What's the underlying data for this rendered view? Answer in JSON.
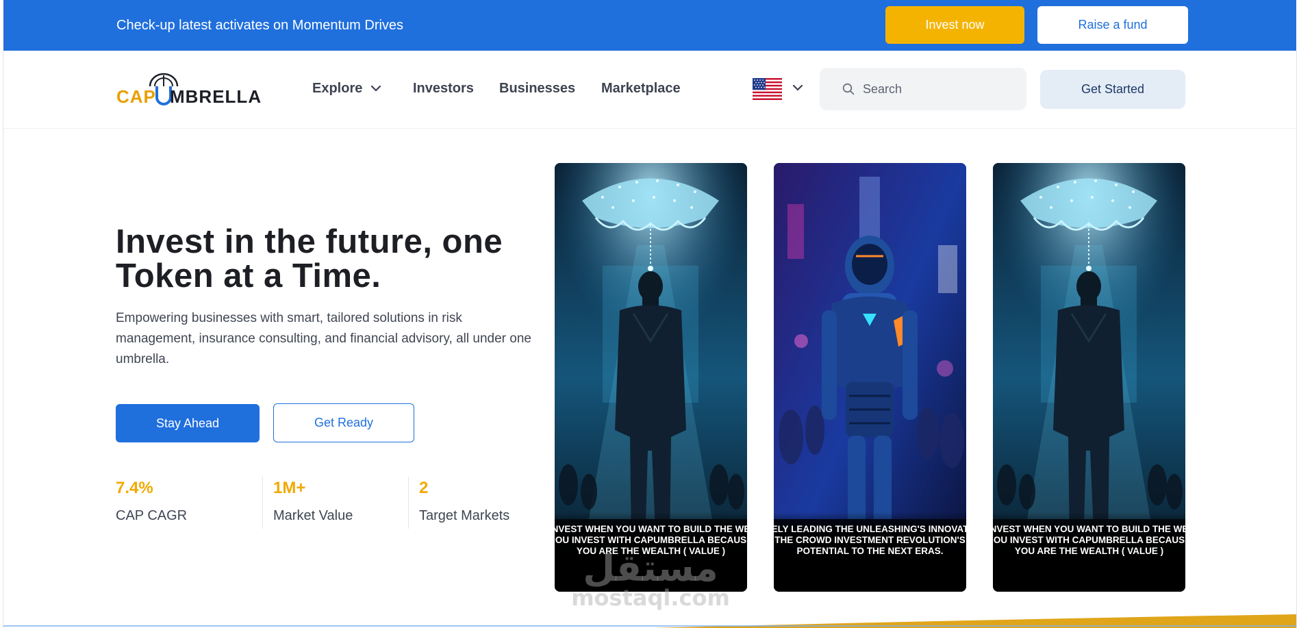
{
  "topbar": {
    "text": "Check-up latest activates on  Momentum Drives",
    "invest_label": "Invest now",
    "raise_label": "Raise a fund",
    "bg_color": "#1f6fdd",
    "invest_color": "#f5b301"
  },
  "logo": {
    "part1": "CAP",
    "part2": "MBRELLA"
  },
  "nav": {
    "explore": "Explore",
    "investors": "Investors",
    "businesses": "Businesses",
    "marketplace": "Marketplace"
  },
  "language": {
    "flag": "us-flag-icon"
  },
  "search": {
    "placeholder": "Search"
  },
  "header": {
    "get_started_label": "Get Started"
  },
  "hero": {
    "title": "Invest in the future, one Token at a Time.",
    "description": "Empowering businesses with smart, tailored solutions in risk management, insurance consulting, and financial advisory, all under one umbrella.",
    "stay_ahead_label": "Stay Ahead",
    "get_ready_label": "Get Ready"
  },
  "stats": [
    {
      "value": "7.4%",
      "label": "CAP CAGR"
    },
    {
      "value": "1M+",
      "label": "Market Value"
    },
    {
      "value": "2",
      "label": "Target Markets"
    }
  ],
  "cards": [
    {
      "caption_l1": "NVEST WHEN YOU WANT TO BUILD THE WE",
      "caption_l2": "OU INVEST WITH CAPUMBRELLA BECAUS",
      "caption_l3": "YOU ARE THE WEALTH ( VALUE )"
    },
    {
      "caption_l1": "ELY LEADING THE UNLEASHING'S INNOVAT",
      "caption_l2": "THE CROWD INVESTMENT REVOLUTION'S",
      "caption_l3": "POTENTIAL TO THE NEXT ERAS."
    },
    {
      "caption_l1": "NVEST WHEN YOU WANT TO BUILD THE WE",
      "caption_l2": "OU INVEST WITH CAPUMBRELLA BECAUS",
      "caption_l3": "YOU ARE THE WEALTH ( VALUE )"
    }
  ],
  "watermark": {
    "arabic": "مستقل",
    "latin": "mostaql.com"
  }
}
